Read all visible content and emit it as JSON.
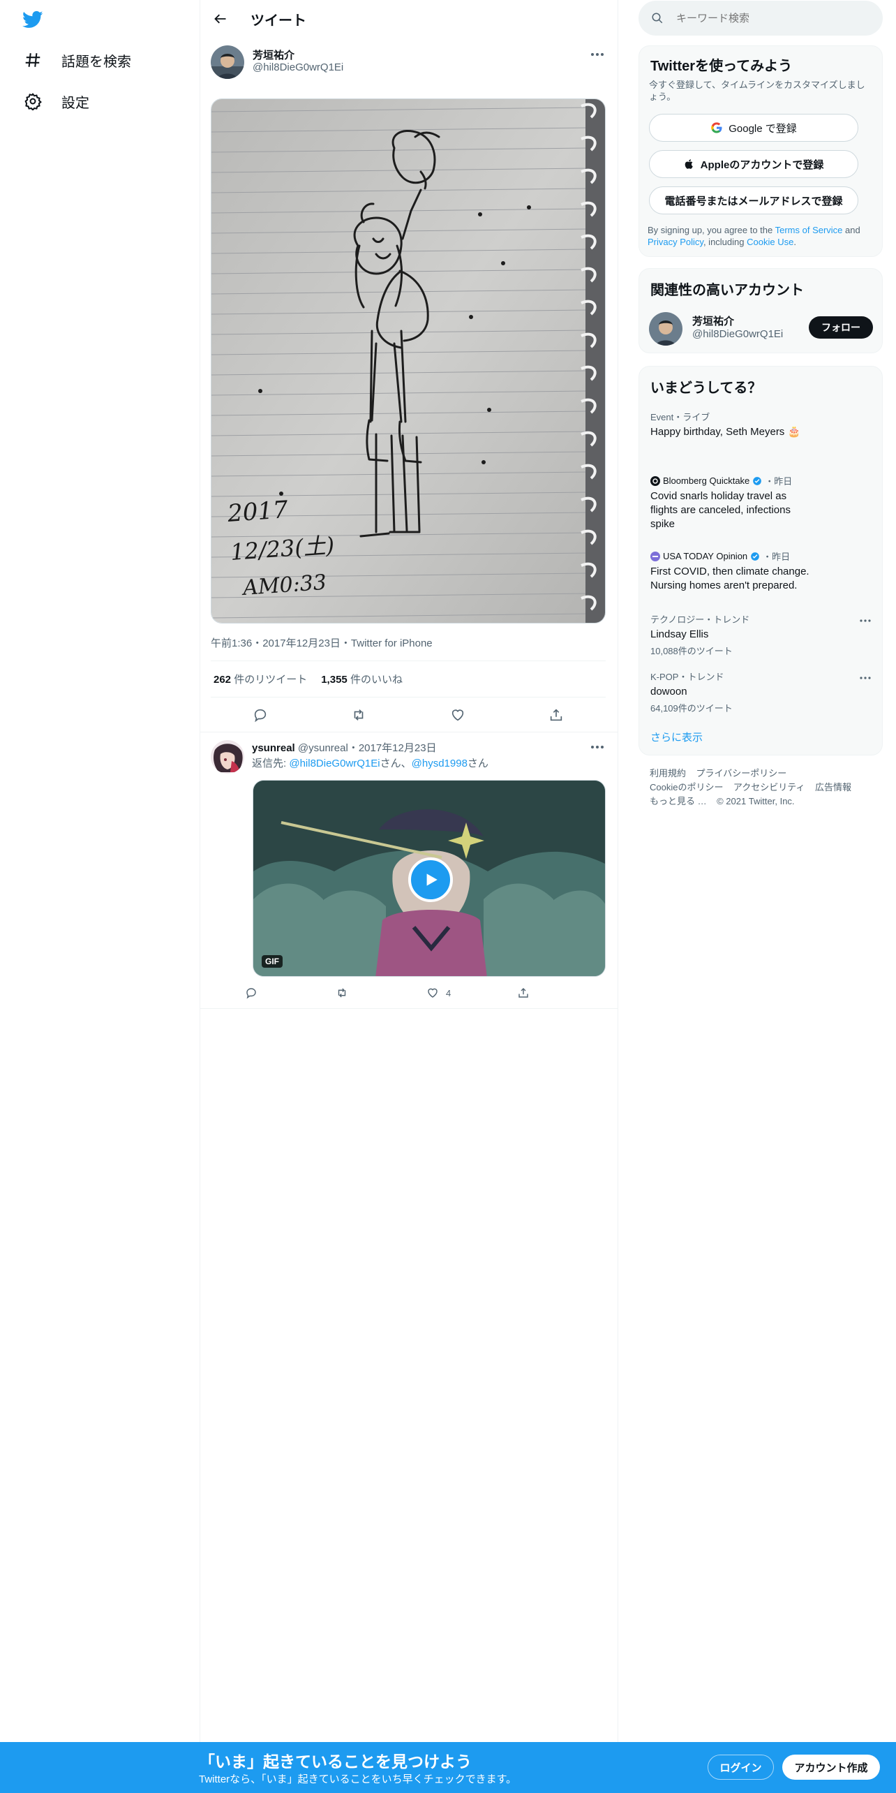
{
  "nav": {
    "items": [
      {
        "label": "話題を検索",
        "icon": "hashtag-icon"
      },
      {
        "label": "設定",
        "icon": "gear-icon"
      }
    ]
  },
  "header": {
    "title": "ツイート"
  },
  "tweet": {
    "author_name": "芳垣祐介",
    "author_handle": "@hil8DieG0wrQ1Ei",
    "photo_text": [
      "2017",
      "12/23(土)",
      "AM0:33"
    ],
    "meta": "午前1:36・2017年12月23日・Twitter for iPhone",
    "retweets_count": "262",
    "retweets_label": "件のリツイート",
    "likes_count": "1,355",
    "likes_label": "件のいいね"
  },
  "reply": {
    "author_name": "ysunreal",
    "author_handle": "@ysunreal",
    "date": "・2017年12月23日",
    "reply_prefix": "返信先: ",
    "mention1": "@hil8DieG0wrQ1Ei",
    "mention1_suffix": "さん、",
    "mention2": "@hysd1998",
    "mention2_suffix": "さん",
    "gif_badge": "GIF",
    "like_count": "4"
  },
  "search": {
    "placeholder": "キーワード検索"
  },
  "signup_card": {
    "title": "Twitterを使ってみよう",
    "subtitle": "今すぐ登録して、タイムラインをカスタマイズしましょう。",
    "google_label": "Google で登録",
    "apple_label": "Appleのアカウントで登録",
    "phone_label": "電話番号またはメールアドレスで登録",
    "terms_prefix": "By signing up, you agree to the ",
    "terms_link": "Terms of Service",
    "terms_and": " and ",
    "privacy_link": "Privacy Policy",
    "including": ", including ",
    "cookie_link": "Cookie Use",
    "period": "."
  },
  "related_card": {
    "title": "関連性の高いアカウント",
    "name": "芳垣祐介",
    "handle": "@hil8DieG0wrQ1Ei",
    "follow_label": "フォロー"
  },
  "trends_card": {
    "title": "いまどうしてる？",
    "items": [
      {
        "context": "Event・ライブ",
        "text": "Happy birthday, Seth Meyers 🎂"
      },
      {
        "source": "Bloomberg Quicktake",
        "time": "・昨日",
        "text": "Covid snarls holiday travel as flights are canceled, infections spike"
      },
      {
        "source": "USA TODAY Opinion",
        "time": "・昨日",
        "text": "First COVID, then climate change. Nursing homes aren't prepared."
      },
      {
        "context": "テクノロジー・トレンド",
        "text": "Lindsay Ellis",
        "count": "10,088件のツイート"
      },
      {
        "context": "K-POP・トレンド",
        "text": "dowoon",
        "count": "64,109件のツイート"
      }
    ],
    "show_more": "さらに表示"
  },
  "footer": {
    "links_row1": [
      "利用規約",
      "プライバシーポリシー"
    ],
    "links_row2": [
      "Cookieのポリシー",
      "アクセシビリティ",
      "広告情報"
    ],
    "more": "もっと見る …",
    "copyright": "© 2021 Twitter, Inc."
  },
  "bottom_bar": {
    "title": "「いま」起きていることを見つけよう",
    "subtitle": "Twitterなら、「いま」起きていることをいち早くチェックできます。",
    "login_label": "ログイン",
    "signup_label": "アカウント作成"
  },
  "colors": {
    "accent": "#1d9bf0",
    "text": "#0f1419",
    "muted": "#536471"
  }
}
